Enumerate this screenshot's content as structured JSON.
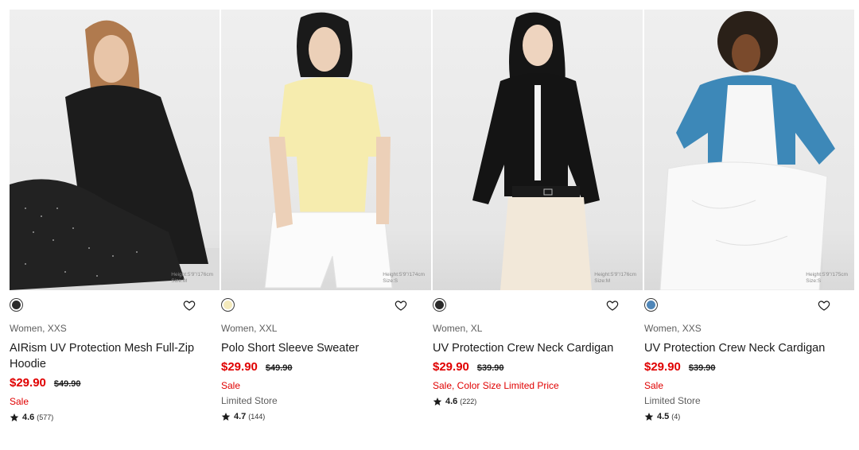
{
  "products": [
    {
      "model_height": "Height:5'9\"/176cm",
      "model_size": "Size:M",
      "swatch_color": "#2a2a2a",
      "gender_size": "Women, XXS",
      "name": "AIRism UV Protection Mesh Full-Zip Hoodie",
      "price": "$29.90",
      "old_price": "$49.90",
      "flags": "Sale",
      "store": "",
      "rating": "4.6",
      "reviews": "(577)"
    },
    {
      "model_height": "Height:5'9\"/174cm",
      "model_size": "Size:S",
      "swatch_color": "#f4eabc",
      "gender_size": "Women, XXL",
      "name": "Polo Short Sleeve Sweater",
      "price": "$29.90",
      "old_price": "$49.90",
      "flags": "Sale",
      "store": "Limited Store",
      "rating": "4.7",
      "reviews": "(144)"
    },
    {
      "model_height": "Height:5'9\"/176cm",
      "model_size": "Size:M",
      "swatch_color": "#2a2a2a",
      "gender_size": "Women, XL",
      "name": "UV Protection Crew Neck Cardigan",
      "price": "$29.90",
      "old_price": "$39.90",
      "flags": "Sale, Color Size Limited Price",
      "store": "",
      "rating": "4.6",
      "reviews": "(222)"
    },
    {
      "model_height": "Height:5'9\"/175cm",
      "model_size": "Size:S",
      "swatch_color": "#4f86b8",
      "gender_size": "Women, XXS",
      "name": "UV Protection Crew Neck Cardigan",
      "price": "$29.90",
      "old_price": "$39.90",
      "flags": "Sale",
      "store": "Limited Store",
      "rating": "4.5",
      "reviews": "(4)"
    }
  ],
  "icons": {
    "wishlist": "heart-outline-icon",
    "rating": "star-icon"
  },
  "colors": {
    "sale_red": "#e00000",
    "text": "#1b1b1b",
    "muted": "#5e5e5e"
  }
}
